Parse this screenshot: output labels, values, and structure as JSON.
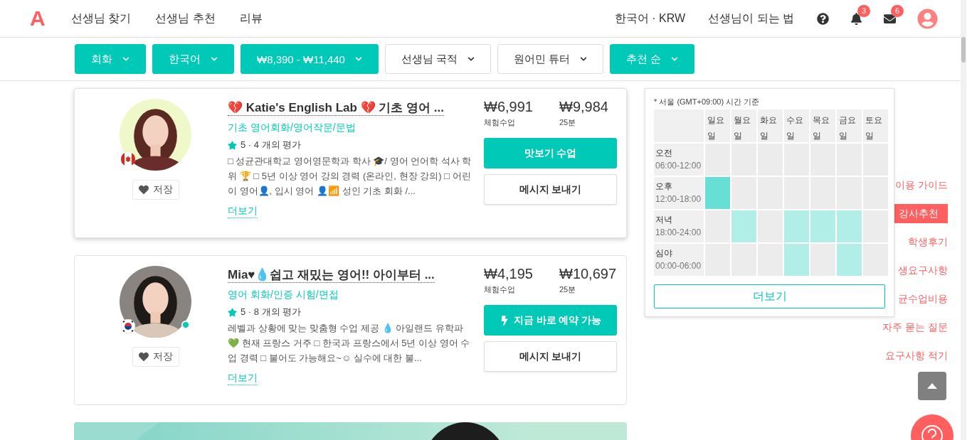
{
  "header": {
    "logo": "A",
    "nav": [
      {
        "label": "선생님 찾기"
      },
      {
        "label": "선생님 추천"
      },
      {
        "label": "리뷰"
      }
    ],
    "language": "한국어 · KRW",
    "become_teacher": "선생님이 되는 법",
    "notifications": "3",
    "messages": "6"
  },
  "filters": [
    {
      "label": "회화",
      "active": true
    },
    {
      "label": "한국어",
      "active": true
    },
    {
      "label": "₩8,390 - ₩11,440",
      "active": true
    },
    {
      "label": "선생님 국적",
      "active": false
    },
    {
      "label": "원어민 튜터",
      "active": false
    },
    {
      "label": "추천 순",
      "active": true
    }
  ],
  "tutors": [
    {
      "title": "💔 Katie's English Lab 💔 기초 영어 ...",
      "subtitle": "기초 영어회화/영어작문/문법",
      "rating": "5 · 4 개의 평가",
      "description": "□ 성균관대학교 영어영문학과 학사 🎓/ 영어 언어학 석사 학위 🏆 □ 5년 이상 영어 강의 경력 (온라인, 현장 강의) □ 어린이 영어👤, 입시 영어 👤📶 성인 기초 회화 /...",
      "more": "더보기",
      "save": "저장",
      "trial_price": "₩6,991",
      "trial_label": "체험수업",
      "price": "₩9,984",
      "price_label": "25분",
      "primary": {
        "label": "맛보기 수업",
        "kind": "trial"
      },
      "message": "메시지 보내기",
      "flag": {
        "kind": "canada"
      },
      "online": false,
      "hovered": true
    },
    {
      "title": "Mia♥💧쉽고 재밌는 영어!! 아이부터 ...",
      "subtitle": "영어 회화/인증 시험/면접",
      "rating": "5 · 8 개의 평가",
      "description": "레벨과 상황에 맞는 맞춤형 수업 제공 💧 아일랜드 유학파 💚 현재 프랑스 거주 □ 한국과 프랑스에서 5년 이상 영어 수업 경력 □ 불어도 가능해요~☺ 실수에 대한 불...",
      "more": "더보기",
      "save": "저장",
      "trial_price": "₩4,195",
      "trial_label": "체험수업",
      "price": "₩10,697",
      "price_label": "25분",
      "primary": {
        "label": "지금 바로 예약 가능",
        "kind": "instant"
      },
      "message": "메시지 보내기",
      "flag": {
        "kind": "korea"
      },
      "online": true,
      "hovered": false
    }
  ],
  "schedule": {
    "note": "* 서울 (GMT+09:00) 시간 기준",
    "days": [
      "일요일",
      "월요일",
      "화요일",
      "수요일",
      "목요일",
      "금요일",
      "토요일"
    ],
    "slots": [
      {
        "name": "오전",
        "hours": "06:00-12:00",
        "cells": [
          {
            "available": false,
            "highlighted": false
          },
          {
            "available": false,
            "highlighted": false
          },
          {
            "available": false,
            "highlighted": false
          },
          {
            "available": false,
            "highlighted": false
          },
          {
            "available": false,
            "highlighted": false
          },
          {
            "available": false,
            "highlighted": false
          },
          {
            "available": false,
            "highlighted": false
          }
        ]
      },
      {
        "name": "오후",
        "hours": "12:00-18:00",
        "cells": [
          {
            "available": true,
            "highlighted": true
          },
          {
            "available": false,
            "highlighted": false
          },
          {
            "available": false,
            "highlighted": false
          },
          {
            "available": false,
            "highlighted": false
          },
          {
            "available": false,
            "highlighted": false
          },
          {
            "available": false,
            "highlighted": false
          },
          {
            "available": false,
            "highlighted": false
          }
        ]
      },
      {
        "name": "저녁",
        "hours": "18:00-24:00",
        "cells": [
          {
            "available": false,
            "highlighted": false
          },
          {
            "available": true,
            "highlighted": false
          },
          {
            "available": false,
            "highlighted": false
          },
          {
            "available": true,
            "highlighted": false
          },
          {
            "available": true,
            "highlighted": false
          },
          {
            "available": true,
            "highlighted": false
          },
          {
            "available": false,
            "highlighted": false
          }
        ]
      },
      {
        "name": "심야",
        "hours": "00:00-06:00",
        "cells": [
          {
            "available": false,
            "highlighted": false
          },
          {
            "available": false,
            "highlighted": false
          },
          {
            "available": false,
            "highlighted": false
          },
          {
            "available": true,
            "highlighted": false
          },
          {
            "available": false,
            "highlighted": false
          },
          {
            "available": true,
            "highlighted": false
          },
          {
            "available": false,
            "highlighted": false
          }
        ]
      }
    ],
    "more": "더보기"
  },
  "side_menu": [
    {
      "label": "이용 가이드",
      "selected": false
    },
    {
      "label": "강사추천",
      "selected": true
    },
    {
      "label": "학생후기",
      "selected": false
    },
    {
      "label": "생요구사항",
      "selected": false
    },
    {
      "label": "균수업비용",
      "selected": false
    },
    {
      "label": "자주 묻는 질문",
      "selected": false
    },
    {
      "label": "요구사항 적기",
      "selected": false
    }
  ]
}
